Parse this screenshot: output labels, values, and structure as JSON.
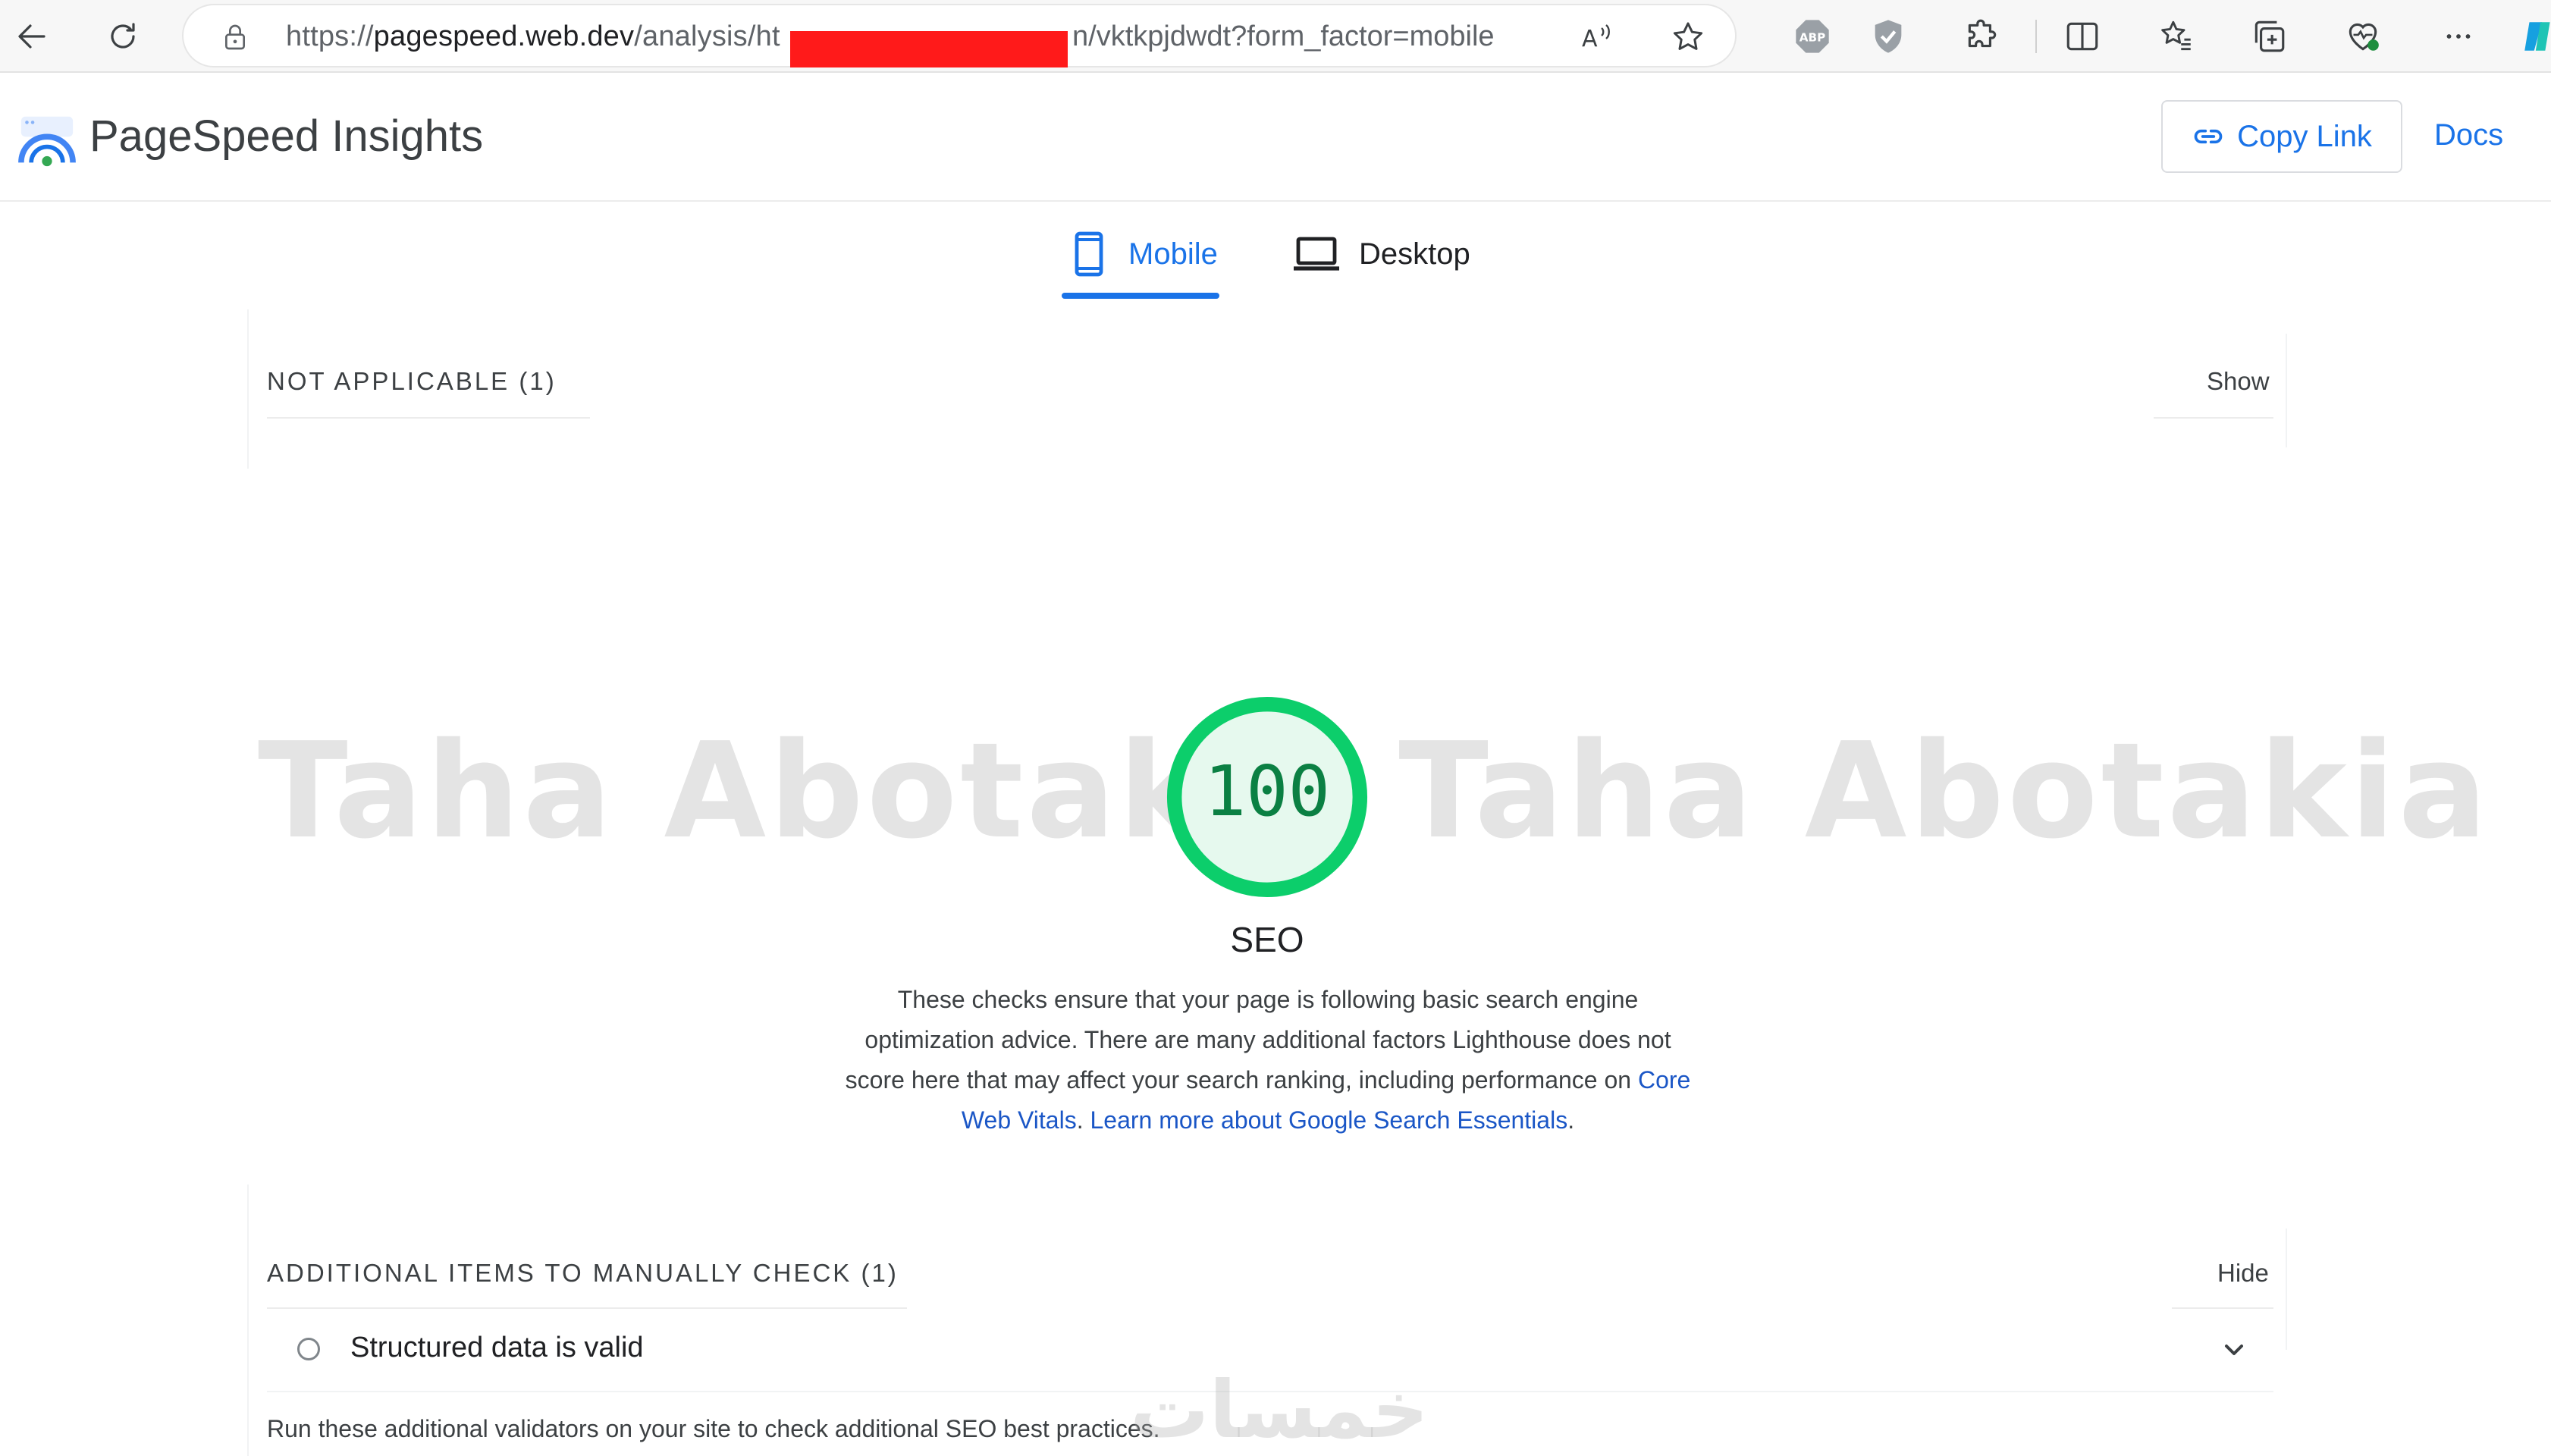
{
  "browser": {
    "url_prefix": "https://",
    "url_host": "pagespeed.web.dev",
    "url_path_start": "/analysis/ht",
    "url_path_end": "n/vktkpjdwdt?form_factor=mobile",
    "extensions": [
      "read-aloud-icon",
      "favorite-star-icon",
      "adblock-plus-icon",
      "shield-extension-icon",
      "extensions-puzzle-icon",
      "split-screen-icon",
      "favorites-icon",
      "collections-icon",
      "health-heart-icon",
      "more-menu-icon",
      "copilot-icon"
    ],
    "extension_labels": {
      "adblock": "ABP"
    }
  },
  "header": {
    "title": "PageSpeed Insights",
    "copy_link_label": "Copy Link",
    "docs_label": "Docs"
  },
  "tabs": [
    {
      "label": "Mobile",
      "selected": true
    },
    {
      "label": "Desktop",
      "selected": false
    }
  ],
  "not_applicable": {
    "title": "NOT APPLICABLE (1)",
    "action": "Show"
  },
  "score": {
    "value": "100",
    "category": "SEO",
    "color": "#0cce6b",
    "description": "These checks ensure that your page is following basic search engine optimization advice. There are many additional factors Lighthouse does not score here that may affect your search ranking, including performance on",
    "link_core_web_vitals": "Core Web Vitals",
    "link_learn_more": "Learn more about Google Search Essentials"
  },
  "manual_check": {
    "title": "ADDITIONAL ITEMS TO MANUALLY CHECK (1)",
    "action": "Hide",
    "items": [
      {
        "label": "Structured data is valid"
      }
    ],
    "note": "Run these additional validators on your site to check additional SEO best practices."
  },
  "watermark": {
    "text": "Taha Abotakia Taha Abotakia",
    "logo_text": "خمسات"
  },
  "colors": {
    "accent": "#1a73e8",
    "score_green": "#0cce6b",
    "score_text": "#0b8043",
    "redaction": "#ff1a1a"
  }
}
